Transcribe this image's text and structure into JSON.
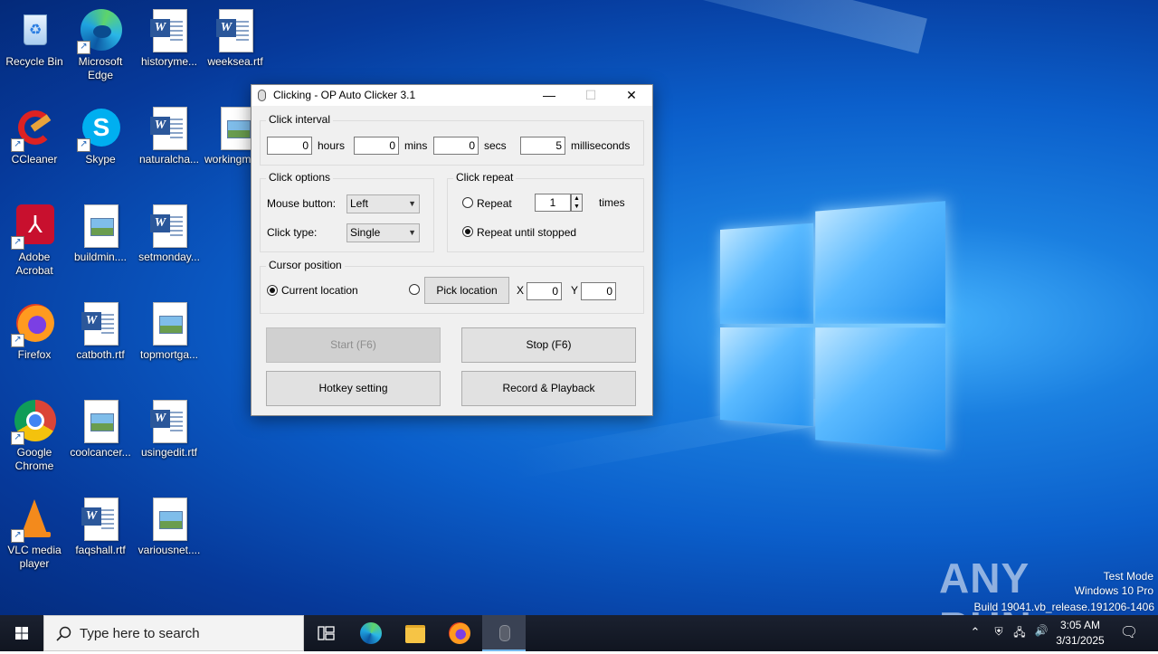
{
  "desktop": {
    "icons": [
      {
        "label": "Recycle Bin"
      },
      {
        "label": "Microsoft Edge"
      },
      {
        "label": "historyme..."
      },
      {
        "label": "weeksea.rtf"
      },
      {
        "label": "CCleaner"
      },
      {
        "label": "Skype"
      },
      {
        "label": "naturalcha..."
      },
      {
        "label": "workingm..."
      },
      {
        "label": "Adobe Acrobat"
      },
      {
        "label": "buildmin...."
      },
      {
        "label": "setmonday..."
      },
      {
        "label": "Firefox"
      },
      {
        "label": "catboth.rtf"
      },
      {
        "label": "topmortga..."
      },
      {
        "label": "Google Chrome"
      },
      {
        "label": "coolcancer..."
      },
      {
        "label": "usingedit.rtf"
      },
      {
        "label": "VLC media player"
      },
      {
        "label": "faqshall.rtf"
      },
      {
        "label": "variousnet...."
      }
    ]
  },
  "window": {
    "title": "Clicking - OP Auto Clicker 3.1",
    "minimize": "—",
    "maximize": "☐",
    "close": "✕",
    "click_interval": {
      "title": "Click interval",
      "hours_value": "0",
      "hours_label": "hours",
      "mins_value": "0",
      "mins_label": "mins",
      "secs_value": "0",
      "secs_label": "secs",
      "ms_value": "5",
      "ms_label": "milliseconds"
    },
    "click_options": {
      "title": "Click options",
      "mouse_button_label": "Mouse button:",
      "mouse_button_value": "Left",
      "click_type_label": "Click type:",
      "click_type_value": "Single"
    },
    "click_repeat": {
      "title": "Click repeat",
      "repeat_label": "Repeat",
      "repeat_count": "1",
      "times_label": "times",
      "until_stopped_label": "Repeat until stopped"
    },
    "cursor_position": {
      "title": "Cursor position",
      "current_label": "Current location",
      "pick_button": "Pick location",
      "x_label": "X",
      "x_value": "0",
      "y_label": "Y",
      "y_value": "0"
    },
    "buttons": {
      "start": "Start (F6)",
      "stop": "Stop (F6)",
      "hotkey": "Hotkey setting",
      "record": "Record & Playback"
    }
  },
  "taskbar": {
    "search_placeholder": "Type here to search",
    "time": "3:05 AM",
    "date": "3/31/2025"
  },
  "watermark": {
    "brand": "ANY RUN",
    "line1": "Test Mode",
    "line2": "Windows 10 Pro",
    "line3": "Build 19041.vb_release.191206-1406"
  }
}
